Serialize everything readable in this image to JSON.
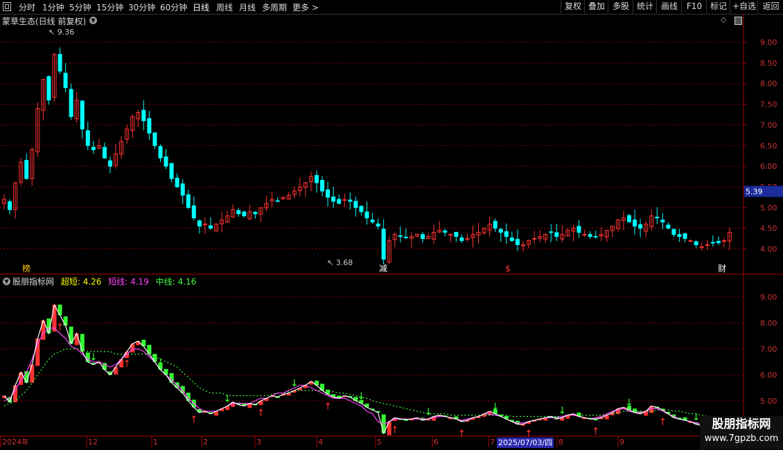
{
  "toolbar": {
    "periods": [
      "分时",
      "1分钟",
      "5分钟",
      "15分钟",
      "30分钟",
      "60分钟",
      "日线",
      "周线",
      "月线",
      "多周期",
      "更多 >"
    ],
    "active_period": "日线",
    "right_buttons": [
      "复权",
      "叠加",
      "多股",
      "统计",
      "画线",
      "F10",
      "标记",
      "+自选",
      "返回"
    ]
  },
  "main_chart": {
    "title": "蒙草生态(日线 前复权)",
    "high_label": "9.36",
    "low_label": "3.68",
    "current_price": "5.39",
    "y_ticks": [
      "9.00",
      "8.50",
      "8.00",
      "7.50",
      "7.00",
      "6.50",
      "6.00",
      "5.50",
      "5.00",
      "4.50",
      "4.00"
    ],
    "event_markers": [
      {
        "text": "榜",
        "color": "#ffcc00"
      },
      {
        "text": "减",
        "color": "#ffffff"
      },
      {
        "text": "$",
        "color": "#ff3333"
      },
      {
        "text": "财",
        "color": "#ffffff"
      }
    ]
  },
  "indicator": {
    "name": "股朋指标网",
    "legends": [
      {
        "label": "超短: 4.26",
        "color": "#ffff00"
      },
      {
        "label": "短线: 4.19",
        "color": "#ff44ff"
      },
      {
        "label": "中线: 4.16",
        "color": "#44ff44"
      }
    ],
    "y_ticks": [
      "9.00",
      "8.00",
      "7.00",
      "6.00",
      "5.00"
    ]
  },
  "x_axis": {
    "labels": [
      "2024年",
      "12",
      "1",
      "2",
      "3",
      "4",
      "5",
      "6",
      "7",
      "8",
      "9"
    ],
    "highlight_date": "2025/07/03/四"
  },
  "watermark": {
    "title": "股朋指标网",
    "url": "www.7gpzb.com"
  },
  "colors": {
    "up": "#ff3333",
    "down": "#00ffff",
    "grid": "#8b0000",
    "axis": "#b00000"
  },
  "chart_data": {
    "type": "candlestick",
    "y_range": [
      3.6,
      9.5
    ],
    "closes": [
      5.2,
      4.95,
      5.6,
      6.1,
      5.7,
      6.4,
      7.4,
      8.1,
      7.6,
      8.7,
      8.3,
      7.9,
      7.2,
      7.6,
      6.9,
      6.5,
      6.4,
      6.5,
      6.2,
      6.0,
      6.3,
      6.6,
      6.9,
      7.2,
      7.3,
      7.1,
      6.8,
      6.5,
      6.2,
      6.0,
      5.7,
      5.5,
      5.3,
      5.0,
      4.75,
      4.55,
      4.6,
      4.5,
      4.6,
      4.7,
      4.8,
      4.95,
      4.85,
      4.8,
      4.9,
      4.85,
      5.0,
      5.1,
      5.2,
      5.15,
      5.25,
      5.3,
      5.4,
      5.5,
      5.6,
      5.75,
      5.6,
      5.4,
      5.25,
      5.15,
      5.1,
      5.2,
      5.15,
      5.0,
      4.9,
      4.75,
      4.65,
      4.55,
      3.75,
      4.2,
      4.35,
      4.3,
      4.28,
      4.3,
      4.35,
      4.25,
      4.3,
      4.4,
      4.45,
      4.4,
      4.35,
      4.3,
      4.2,
      4.25,
      4.35,
      4.4,
      4.5,
      4.6,
      4.5,
      4.4,
      4.3,
      4.2,
      4.1,
      4.1,
      4.2,
      4.25,
      4.3,
      4.35,
      4.4,
      4.3,
      4.35,
      4.45,
      4.5,
      4.4,
      4.35,
      4.3,
      4.3,
      4.35,
      4.45,
      4.55,
      4.7,
      4.75,
      4.65,
      4.55,
      4.5,
      4.6,
      4.8,
      4.75,
      4.65,
      4.5,
      4.35,
      4.3,
      4.25,
      4.2,
      4.1,
      4.05,
      4.1,
      4.15,
      4.15,
      4.2,
      4.4
    ],
    "ma_short": [
      5.0,
      5.1,
      5.4,
      5.8,
      6.1,
      6.6,
      7.2,
      7.6,
      7.8,
      7.8,
      7.6,
      7.4,
      7.1,
      7.0,
      6.8,
      6.6,
      6.5,
      6.5,
      6.4,
      6.3,
      6.4,
      6.6,
      6.8,
      7.0,
      7.0,
      6.9,
      6.7,
      6.5,
      6.2,
      6.0,
      5.8,
      5.6,
      5.4,
      5.1,
      4.9,
      4.7,
      4.6,
      4.6,
      4.6,
      4.7,
      4.8,
      4.9,
      4.9,
      4.9,
      4.9,
      5.0,
      5.1,
      5.1,
      5.2,
      5.3,
      5.3,
      5.4,
      5.5,
      5.6,
      5.6,
      5.5,
      5.4,
      5.3,
      5.2,
      5.1,
      5.1,
      5.1,
      5.0,
      4.9,
      4.8,
      4.6,
      4.5,
      4.2,
      4.1,
      4.2,
      4.3,
      4.3,
      4.3,
      4.3,
      4.3,
      4.3,
      4.3,
      4.35,
      4.4,
      4.4,
      4.35,
      4.3,
      4.25,
      4.3,
      4.35,
      4.4,
      4.5,
      4.5,
      4.45,
      4.4,
      4.3,
      4.2,
      4.15,
      4.15,
      4.2,
      4.25,
      4.3,
      4.35,
      4.35,
      4.35,
      4.4,
      4.45,
      4.45,
      4.4,
      4.35,
      4.3,
      4.35,
      4.4,
      4.5,
      4.6,
      4.65,
      4.7,
      4.6,
      4.55,
      4.55,
      4.6,
      4.7,
      4.7,
      4.6,
      4.5,
      4.4,
      4.3,
      4.25,
      4.2,
      4.15,
      4.1,
      4.1,
      4.15,
      4.2,
      4.2,
      4.25
    ],
    "ma_mid": [
      4.8,
      4.9,
      5.0,
      5.2,
      5.4,
      5.7,
      6.0,
      6.3,
      6.6,
      6.8,
      6.9,
      7.0,
      7.0,
      7.0,
      7.0,
      6.9,
      6.9,
      6.9,
      6.9,
      6.9,
      6.8,
      6.8,
      6.8,
      6.8,
      6.8,
      6.8,
      6.8,
      6.7,
      6.6,
      6.5,
      6.4,
      6.3,
      6.1,
      5.9,
      5.7,
      5.5,
      5.4,
      5.3,
      5.3,
      5.3,
      5.2,
      5.2,
      5.2,
      5.2,
      5.2,
      5.2,
      5.2,
      5.2,
      5.25,
      5.3,
      5.3,
      5.35,
      5.4,
      5.4,
      5.4,
      5.4,
      5.4,
      5.4,
      5.4,
      5.35,
      5.3,
      5.3,
      5.25,
      5.2,
      5.15,
      5.1,
      5.0,
      4.95,
      4.9,
      4.85,
      4.8,
      4.75,
      4.7,
      4.65,
      4.6,
      4.55,
      4.5,
      4.5,
      4.5,
      4.5,
      4.45,
      4.45,
      4.45,
      4.45,
      4.45,
      4.45,
      4.45,
      4.45,
      4.45,
      4.45,
      4.45,
      4.4,
      4.4,
      4.4,
      4.4,
      4.4,
      4.4,
      4.4,
      4.4,
      4.4,
      4.4,
      4.45,
      4.45,
      4.45,
      4.45,
      4.45,
      4.45,
      4.45,
      4.5,
      4.5,
      4.55,
      4.6,
      4.6,
      4.6,
      4.6,
      4.6,
      4.6,
      4.65,
      4.65,
      4.65,
      4.6,
      4.6,
      4.55,
      4.5,
      4.5,
      4.45,
      4.4,
      4.4,
      4.35,
      4.35,
      4.3
    ]
  }
}
